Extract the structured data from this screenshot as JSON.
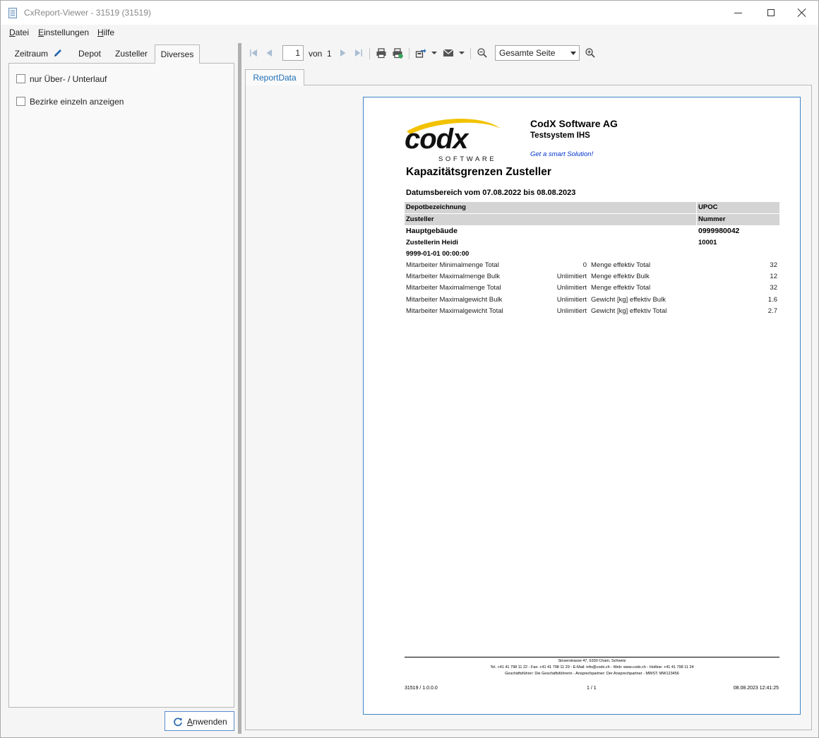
{
  "window": {
    "title": "CxReport-Viewer - 31519 (31519)"
  },
  "menu": {
    "items": [
      {
        "first": "D",
        "rest": "atei"
      },
      {
        "first": "E",
        "rest": "instellungen"
      },
      {
        "first": "H",
        "rest": "ilfe"
      }
    ]
  },
  "left": {
    "tabs": [
      "Zeitraum",
      "Depot",
      "Zusteller",
      "Diverses"
    ],
    "active_tab": "Diverses",
    "checkboxes": [
      {
        "label": "nur Über- / Unterlauf",
        "checked": false
      },
      {
        "label": "Bezirke einzeln anzeigen",
        "checked": false
      }
    ],
    "apply_first": "A",
    "apply_rest": "nwenden"
  },
  "toolbar": {
    "page_value": "1",
    "of_label": "von",
    "page_total": "1",
    "zoom_value": "Gesamte Seite"
  },
  "report_tab": "ReportData",
  "report": {
    "company": "CodX Software AG",
    "system": "Testsystem IHS",
    "slogan": "Get a smart Solution!",
    "logo_word": "codx",
    "logo_sub": "SOFTWARE",
    "title": "Kapazitätsgrenzen Zusteller",
    "date_range": "Datumsbereich vom 07.08.2022 bis 08.08.2023",
    "header1_left": "Depotbezeichnung",
    "header1_right": "UPOC",
    "header2_left": "Zusteller",
    "header2_right": "Nummer",
    "depot_name": "Hauptgebäude",
    "depot_number": "0999980042",
    "carrier_name": "Zustellerin Heidi",
    "carrier_number": "10001",
    "datetime": "9999-01-01 00:00:00",
    "rows": [
      {
        "label": "Mitarbeiter Minimalmenge Total",
        "limit": "0",
        "eff_label": "Menge effektiv Total",
        "eff_value": "32"
      },
      {
        "label": "Mitarbeiter Maximalmenge Bulk",
        "limit": "Unlimitiert",
        "eff_label": "Menge effektiv Bulk",
        "eff_value": "12"
      },
      {
        "label": "Mitarbeiter Maximalmenge Total",
        "limit": "Unlimitiert",
        "eff_label": "Menge effektiv Total",
        "eff_value": "32"
      },
      {
        "label": "Mitarbeiter Maximalgewicht Bulk",
        "limit": "Unlimitiert",
        "eff_label": "Gewicht [kg] effektiv Bulk",
        "eff_value": "1.6"
      },
      {
        "label": "Mitarbeiter Maximalgewicht Total",
        "limit": "Unlimitiert",
        "eff_label": "Gewicht [kg] effektiv Total",
        "eff_value": "2.7"
      }
    ],
    "footer_address": "Sinserstrasse 47, 6330 Cham, Schweiz",
    "footer_contact": "Tel. +41 41 798 11 22 - Fax: +41 41 798 11 29 - E-Mail: info@codx.ch - Web: www.codx.ch - Hotline: +41 41 798 11 24",
    "footer_people": "Geschäftsführer: Die Geschäftsführerin - Ansprechpartner: Der Ansprechpartner - MWST: MW123456",
    "footer_left": "31519 / 1.0.0.0",
    "footer_center": "1 / 1",
    "footer_right": "08.08.2023 12:41:25"
  },
  "colors": {
    "accent": "#3f86c6",
    "link": "#1f6fb5",
    "slogan": "#0033cc",
    "logo_swoosh": "#f2c200"
  }
}
